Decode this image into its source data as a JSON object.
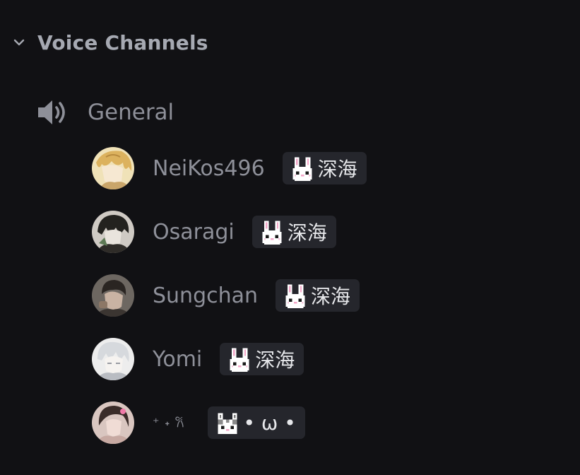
{
  "category": {
    "label": "Voice Channels",
    "icon": "chevron-down-icon"
  },
  "channel": {
    "label": "General",
    "icon": "speaker-icon"
  },
  "users": [
    {
      "name": "NeiKos496",
      "avatar": "blond-anime-avatar",
      "tag_icon": "pixel-bunny-icon",
      "tag_text": "深海"
    },
    {
      "name": "Osaragi",
      "avatar": "dark-haired-manga-avatar",
      "tag_icon": "pixel-bunny-icon",
      "tag_text": "深海"
    },
    {
      "name": "Sungchan",
      "avatar": "portrait-photo-avatar",
      "tag_icon": "pixel-bunny-icon",
      "tag_text": "深海"
    },
    {
      "name": "Yomi",
      "avatar": "white-haired-avatar",
      "tag_icon": "pixel-bunny-icon",
      "tag_text": "深海"
    },
    {
      "name": "⁺ ˖ 𐙚",
      "avatar": "pink-portrait-avatar",
      "tag_icon": "pixel-cat-icon",
      "tag_text": "• ω •"
    }
  ],
  "colors": {
    "background": "#111114",
    "category_text": "#a6a9b2",
    "muted_text": "#8e9099",
    "tag_background": "#25262c",
    "tag_text": "#e6e7ea"
  }
}
